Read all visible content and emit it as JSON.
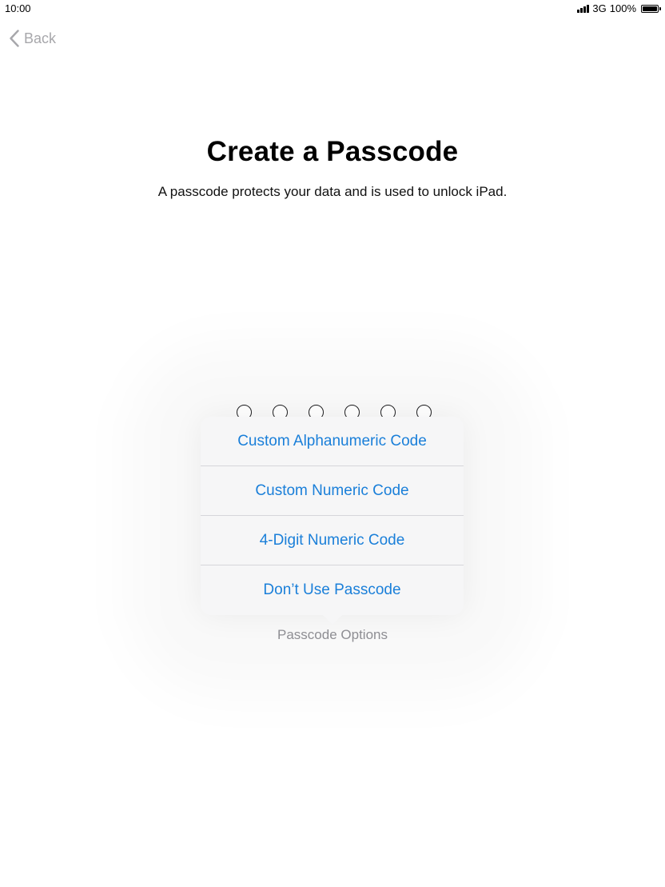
{
  "status_bar": {
    "time": "10:00",
    "network": "3G",
    "battery_percent": "100%",
    "signal_bars": 4,
    "battery_level": 1.0
  },
  "nav": {
    "back_label": "Back"
  },
  "header": {
    "title": "Create a Passcode",
    "subtitle": "A passcode protects your data and is used to unlock iPad."
  },
  "passcode": {
    "digit_count": 6,
    "entered": 0
  },
  "popover": {
    "items": [
      {
        "label": "Custom Alphanumeric Code"
      },
      {
        "label": "Custom Numeric Code"
      },
      {
        "label": "4-Digit Numeric Code"
      },
      {
        "label": "Don’t Use Passcode"
      }
    ]
  },
  "options_link": "Passcode Options",
  "colors": {
    "accent": "#1a7fd9",
    "back_gray": "#a7a7ab",
    "secondary_gray": "#8e8e93"
  }
}
